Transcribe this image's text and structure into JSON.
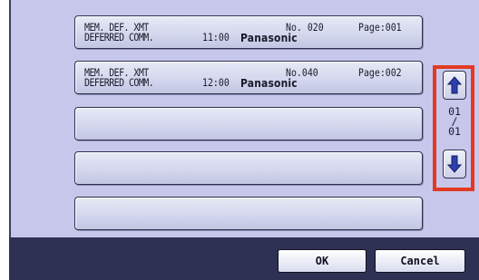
{
  "job_list": [
    {
      "type": "MEM. DEF. XMT",
      "mode": "DEFERRED COMM.",
      "time": "11:00",
      "company": "Panasonic",
      "number": "No. 020",
      "page": "Page:001"
    },
    {
      "type": "MEM. DEF. XMT",
      "mode": "DEFERRED COMM.",
      "time": "12:00",
      "company": "Panasonic",
      "number": "No.040",
      "page": "Page:002"
    }
  ],
  "scroll": {
    "page_current": "01",
    "page_separator": "/",
    "page_total": "01",
    "up_icon": "arrow-up-icon",
    "down_icon": "arrow-down-icon"
  },
  "footer": {
    "ok_label": "OK",
    "cancel_label": "Cancel"
  },
  "colors": {
    "panel_bg": "#c7c7ec",
    "footer_bg": "#2f3154",
    "highlight": "#e23a22",
    "arrow_blue": "#2b3fae"
  }
}
